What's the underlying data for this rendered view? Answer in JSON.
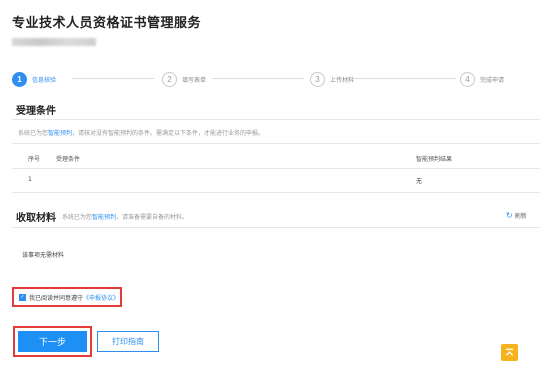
{
  "page_title": "专业技术人员资格证书管理服务",
  "steps": [
    {
      "num": "1",
      "label": "信息核验"
    },
    {
      "num": "2",
      "label": "填写表单"
    },
    {
      "num": "3",
      "label": "上传材料"
    },
    {
      "num": "4",
      "label": "完成申请"
    }
  ],
  "conditions": {
    "title": "受理条件",
    "hint_prefix": "系统已为您",
    "hint_link": "智能预判",
    "hint_suffix": "，请核对没有智能预判的条件。需满足以下条件，才能进行业务的申报。",
    "columns": {
      "no": "序号",
      "condition": "受理条件",
      "result": "智能预判结果"
    },
    "rows": [
      {
        "no": "1",
        "condition": "",
        "result": "无"
      }
    ]
  },
  "materials": {
    "title": "收取材料",
    "hint_prefix": "系统已为您",
    "hint_link": "智能预判",
    "hint_suffix": "，请准备需要自备的材料。",
    "refresh_label": "刷新",
    "empty_text": "该事项无需材料"
  },
  "agreement": {
    "text": "我已阅读并同意遵守",
    "link": "《申报协议》"
  },
  "buttons": {
    "next": "下一步",
    "print": "打印指南"
  },
  "colors": {
    "accent": "#2f8ff0",
    "highlight_border": "#e33a3a",
    "back_top": "#f6b31e"
  },
  "icons": {
    "refresh": "refresh-icon",
    "back_top": "arrow-up-icon",
    "checkbox": "check-icon"
  }
}
